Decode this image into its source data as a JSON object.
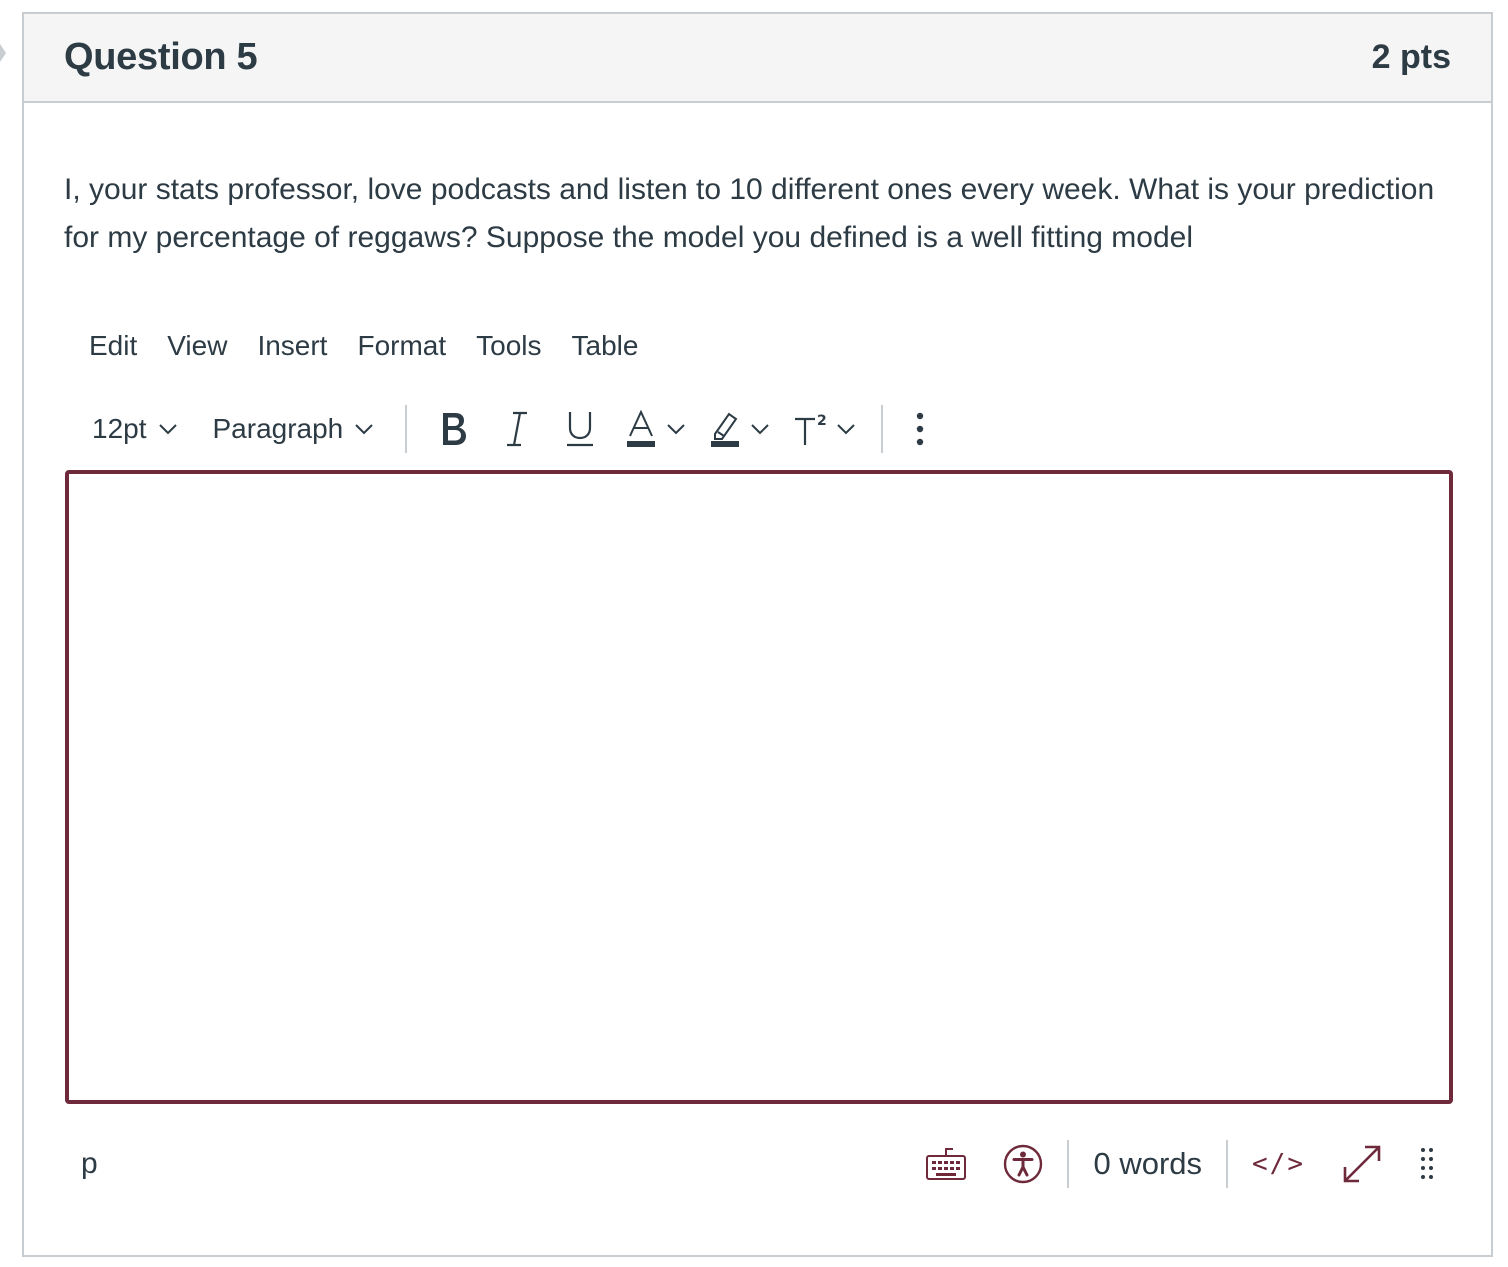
{
  "question": {
    "title": "Question 5",
    "points": "2 pts",
    "text": "I, your stats professor, love podcasts and listen to 10 different ones every week. What is your prediction for my percentage of reggaws? Suppose the model you defined is a well fitting model"
  },
  "editor": {
    "menu": [
      "Edit",
      "View",
      "Insert",
      "Format",
      "Tools",
      "Table"
    ],
    "font_size": "12pt",
    "block_format": "Paragraph",
    "content": "",
    "path": "p",
    "word_count": "0 words",
    "html_toggle": "</>",
    "accent_color": "#6e2a3a",
    "icons": [
      "bold-icon",
      "italic-icon",
      "underline-icon",
      "text-color-icon",
      "highlight-icon",
      "superscript-icon",
      "more-options-icon",
      "keyboard-icon",
      "accessibility-icon",
      "fullscreen-icon",
      "resize-handle-icon"
    ]
  }
}
